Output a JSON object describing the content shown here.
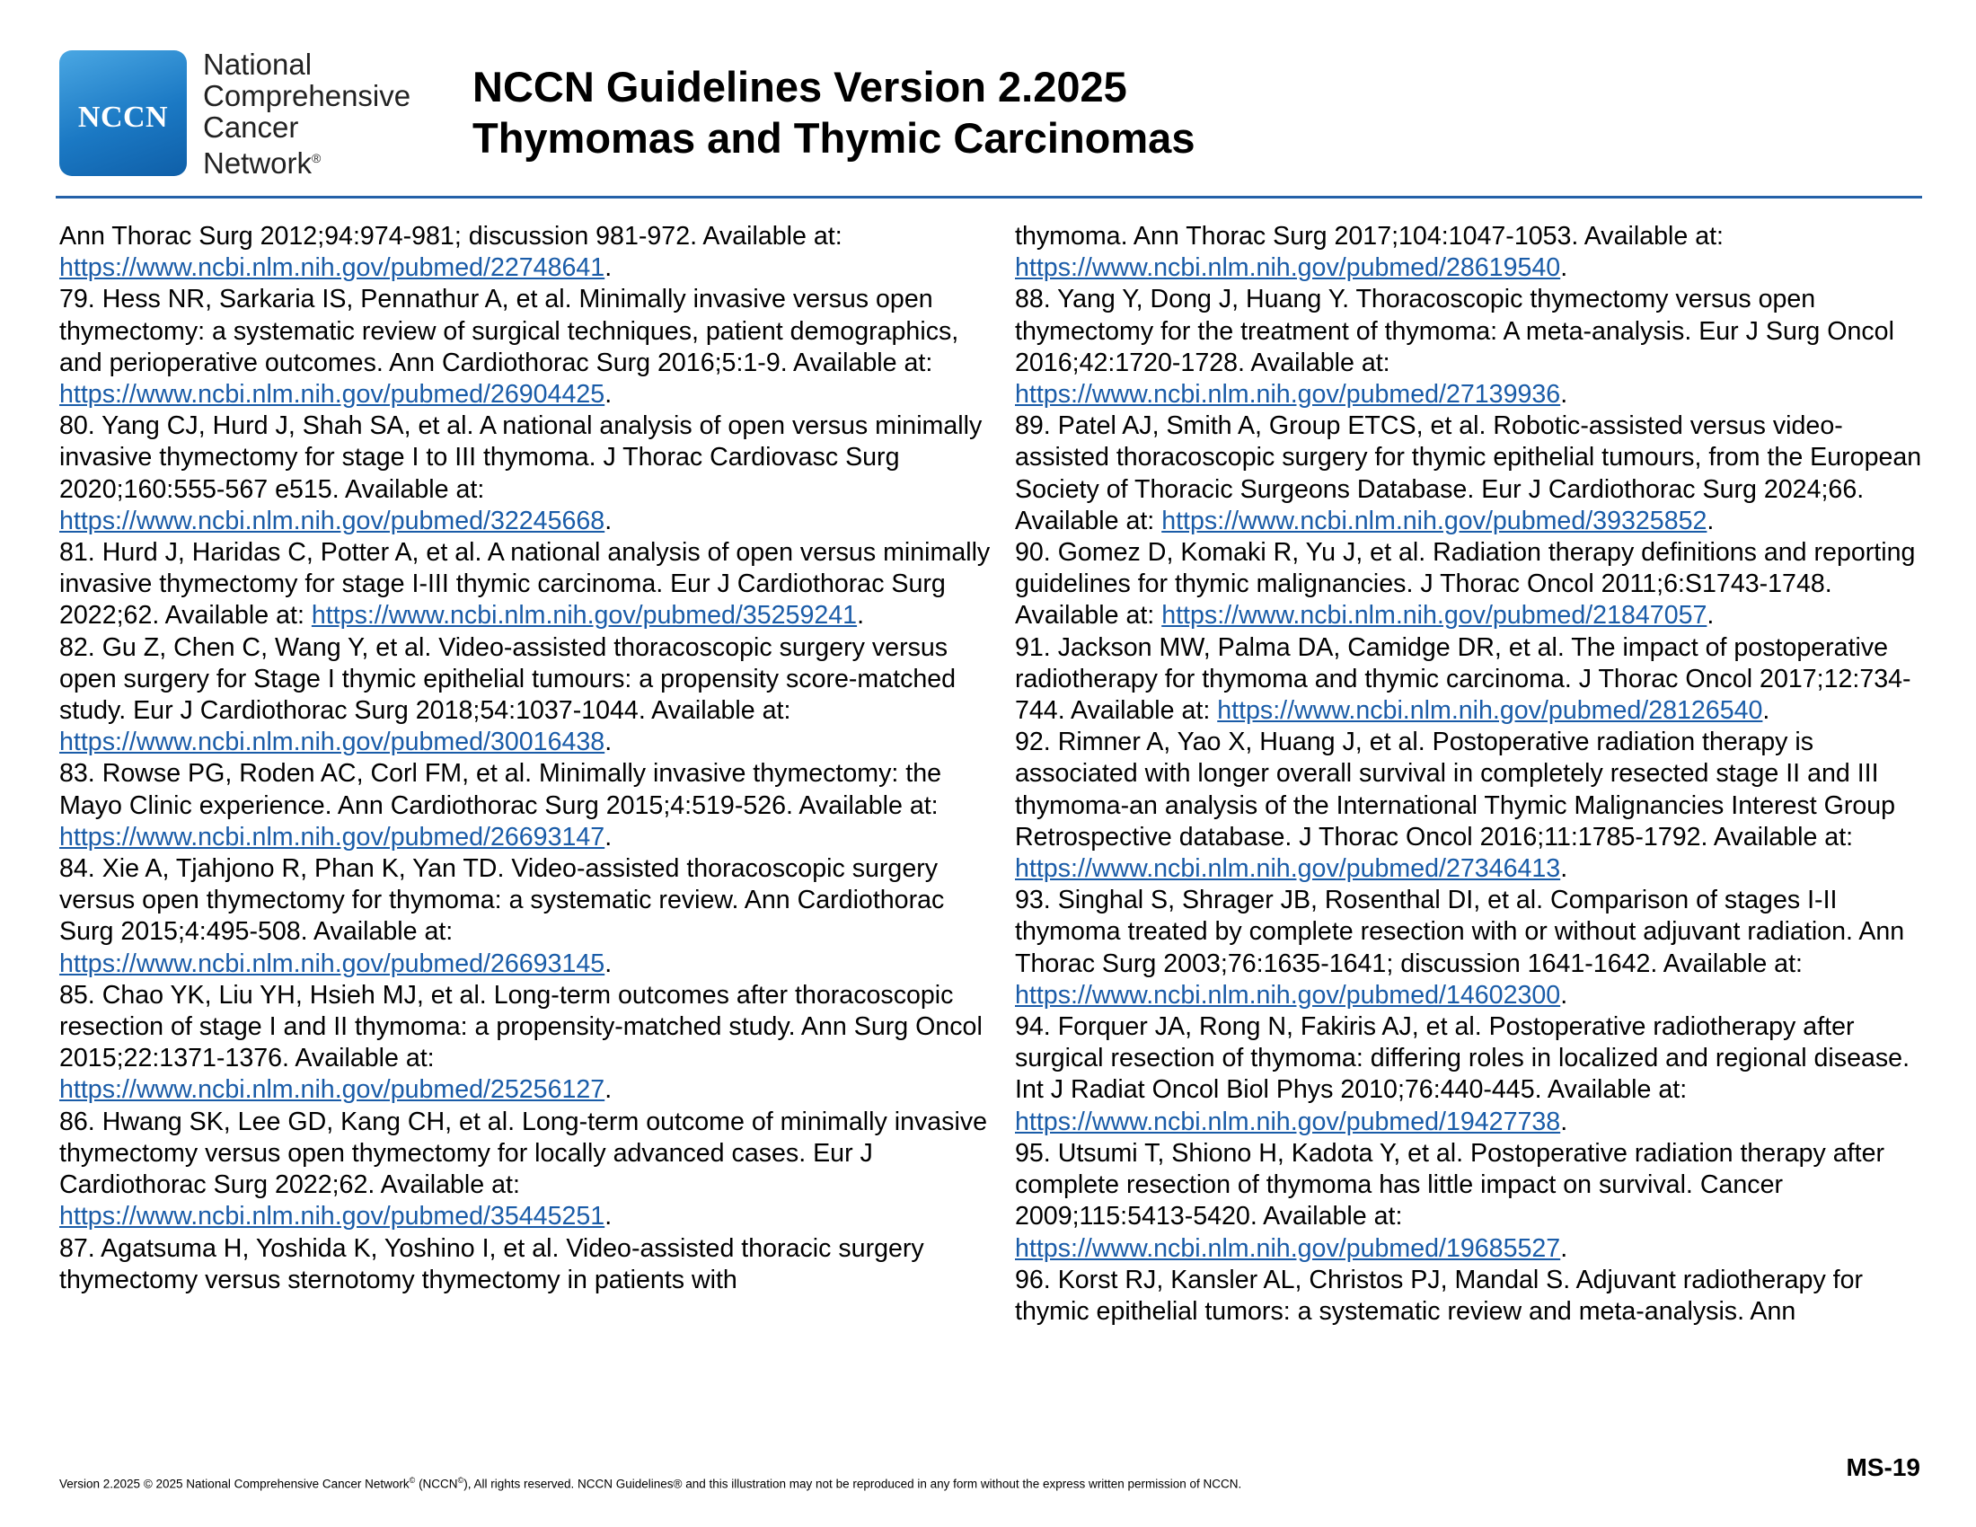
{
  "header": {
    "logo_text": "NCCN",
    "org_lines": [
      "National",
      "Comprehensive",
      "Cancer",
      "Network"
    ],
    "org_reg": "®",
    "title_line1": "NCCN Guidelines Version 2.2025",
    "title_line2": "Thymomas and Thymic Carcinomas"
  },
  "left_column": [
    {
      "text": "Ann Thorac Surg 2012;94:974-981; discussion 981-972. Available at: ",
      "link": "https://www.ncbi.nlm.nih.gov/pubmed/22748641"
    },
    {
      "text": "79. Hess NR, Sarkaria IS, Pennathur A, et al. Minimally invasive versus open thymectomy: a systematic review of surgical techniques, patient demographics, and perioperative outcomes. Ann Cardiothorac Surg 2016;5:1-9. Available at: ",
      "link": "https://www.ncbi.nlm.nih.gov/pubmed/26904425"
    },
    {
      "text": "80. Yang CJ, Hurd J, Shah SA, et al. A national analysis of open versus minimally invasive thymectomy for stage I to III thymoma. J Thorac Cardiovasc Surg 2020;160:555-567 e515. Available at: ",
      "link": "https://www.ncbi.nlm.nih.gov/pubmed/32245668"
    },
    {
      "text": "81. Hurd J, Haridas C, Potter A, et al. A national analysis of open versus minimally invasive thymectomy for stage I-III thymic carcinoma. Eur J Cardiothorac Surg 2022;62. Available at: ",
      "link": "https://www.ncbi.nlm.nih.gov/pubmed/35259241"
    },
    {
      "text": "82. Gu Z, Chen C, Wang Y, et al. Video-assisted thoracoscopic surgery versus open surgery for Stage I thymic epithelial tumours: a propensity score-matched study. Eur J Cardiothorac Surg 2018;54:1037-1044. Available at: ",
      "link": "https://www.ncbi.nlm.nih.gov/pubmed/30016438"
    },
    {
      "text": "83. Rowse PG, Roden AC, Corl FM, et al. Minimally invasive thymectomy: the Mayo Clinic experience. Ann Cardiothorac Surg 2015;4:519-526. Available at: ",
      "link": "https://www.ncbi.nlm.nih.gov/pubmed/26693147"
    },
    {
      "text": "84. Xie A, Tjahjono R, Phan K, Yan TD. Video-assisted thoracoscopic surgery versus open thymectomy for thymoma: a systematic review. Ann Cardiothorac Surg 2015;4:495-508. Available at: ",
      "link": "https://www.ncbi.nlm.nih.gov/pubmed/26693145"
    },
    {
      "text": "85. Chao YK, Liu YH, Hsieh MJ, et al. Long-term outcomes after thoracoscopic resection of stage I and II thymoma: a propensity-matched study. Ann Surg Oncol 2015;22:1371-1376. Available at: ",
      "link": "https://www.ncbi.nlm.nih.gov/pubmed/25256127"
    },
    {
      "text": "86. Hwang SK, Lee GD, Kang CH, et al. Long-term outcome of minimally invasive thymectomy versus open thymectomy for locally advanced cases. Eur J Cardiothorac Surg 2022;62. Available at: ",
      "link": "https://www.ncbi.nlm.nih.gov/pubmed/35445251"
    },
    {
      "text": "87. Agatsuma H, Yoshida K, Yoshino I, et al. Video-assisted thoracic surgery thymectomy versus sternotomy thymectomy in patients with",
      "link": ""
    }
  ],
  "right_column": [
    {
      "text": "thymoma. Ann Thorac Surg 2017;104:1047-1053. Available at: ",
      "link": "https://www.ncbi.nlm.nih.gov/pubmed/28619540"
    },
    {
      "text": "88. Yang Y, Dong J, Huang Y. Thoracoscopic thymectomy versus open thymectomy for the treatment of thymoma: A meta-analysis. Eur J Surg Oncol 2016;42:1720-1728. Available at: ",
      "link": "https://www.ncbi.nlm.nih.gov/pubmed/27139936"
    },
    {
      "text": "89. Patel AJ, Smith A, Group ETCS, et al. Robotic-assisted versus video-assisted thoracoscopic surgery for thymic epithelial tumours, from the European Society of Thoracic Surgeons Database. Eur J Cardiothorac Surg 2024;66. Available at: ",
      "link": "https://www.ncbi.nlm.nih.gov/pubmed/39325852"
    },
    {
      "text": "90. Gomez D, Komaki R, Yu J, et al. Radiation therapy definitions and reporting guidelines for thymic malignancies. J Thorac Oncol 2011;6:S1743-1748. Available at: ",
      "link": "https://www.ncbi.nlm.nih.gov/pubmed/21847057"
    },
    {
      "text": "91. Jackson MW, Palma DA, Camidge DR, et al. The impact of postoperative radiotherapy for thymoma and thymic carcinoma. J Thorac Oncol 2017;12:734-744. Available at: ",
      "link": "https://www.ncbi.nlm.nih.gov/pubmed/28126540"
    },
    {
      "text": "92. Rimner A, Yao X, Huang J, et al. Postoperative radiation therapy is associated with longer overall survival in completely resected stage II and III thymoma-an analysis of the International Thymic Malignancies Interest Group Retrospective database. J Thorac Oncol 2016;11:1785-1792. Available at: ",
      "link": "https://www.ncbi.nlm.nih.gov/pubmed/27346413"
    },
    {
      "text": "93. Singhal S, Shrager JB, Rosenthal DI, et al. Comparison of stages I-II thymoma treated by complete resection with or without adjuvant radiation. Ann Thorac Surg 2003;76:1635-1641; discussion 1641-1642. Available at: ",
      "link": "https://www.ncbi.nlm.nih.gov/pubmed/14602300"
    },
    {
      "text": "94. Forquer JA, Rong N, Fakiris AJ, et al. Postoperative radiotherapy after surgical resection of thymoma: differing roles in localized and regional disease. Int J Radiat Oncol Biol Phys 2010;76:440-445. Available at: ",
      "link": "https://www.ncbi.nlm.nih.gov/pubmed/19427738"
    },
    {
      "text": "95. Utsumi T, Shiono H, Kadota Y, et al. Postoperative radiation therapy after complete resection of thymoma has little impact on survival. Cancer 2009;115:5413-5420. Available at: ",
      "link": "https://www.ncbi.nlm.nih.gov/pubmed/19685527"
    },
    {
      "text": "96. Korst RJ, Kansler AL, Christos PJ, Mandal S. Adjuvant radiotherapy for thymic epithelial tumors: a systematic review and meta-analysis. Ann",
      "link": ""
    }
  ],
  "footer": {
    "part1": "Version 2.2025 © 2025 National Comprehensive Cancer Network",
    "reg1": "©",
    "part2": " (NCCN",
    "reg2": "©",
    "part3": "), All rights reserved. NCCN Guidelines® and this illustration may not be reproduced in any form without the express written permission of NCCN.",
    "page": "MS-19"
  }
}
